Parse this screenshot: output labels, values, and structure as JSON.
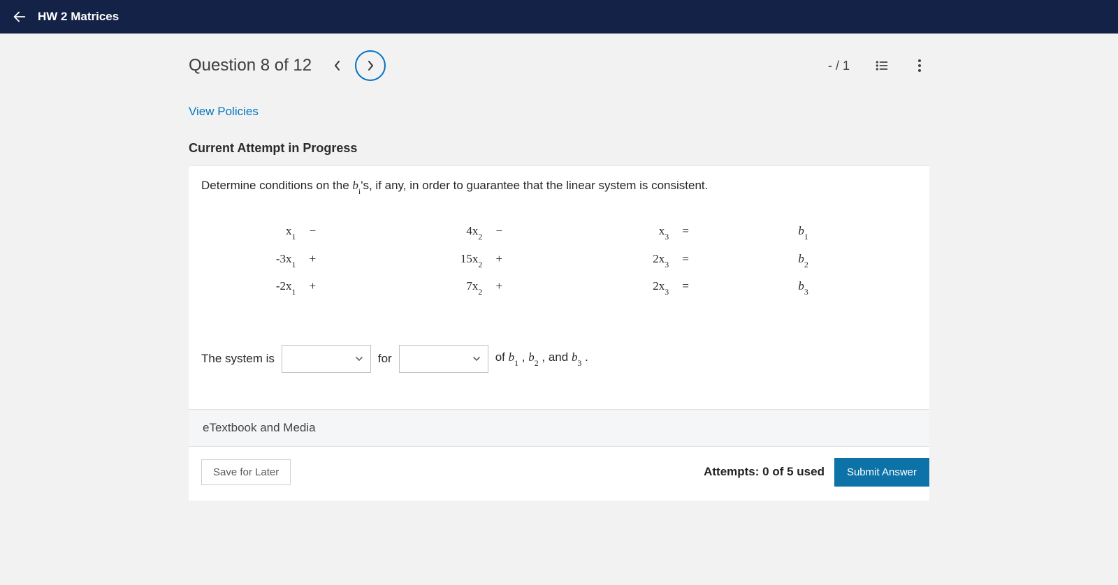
{
  "header": {
    "title": "HW 2 Matrices"
  },
  "question_nav": {
    "label": "Question 8 of 12",
    "score": "- / 1"
  },
  "links": {
    "view_policies": "View Policies"
  },
  "attempt": {
    "status_title": "Current Attempt in Progress"
  },
  "prompt": {
    "pre": "Determine conditions on the ",
    "var_html": "b_i",
    "post": "'s, if any, in order to guarantee that the linear system is consistent."
  },
  "equations": {
    "rows": [
      {
        "c1": "x",
        "s1": "1",
        "op1": "−",
        "c2": "4x",
        "s2": "2",
        "op2": "−",
        "c3": "x",
        "s3": "3",
        "eq": "=",
        "b": "b",
        "bs": "1"
      },
      {
        "c1": "-3x",
        "s1": "1",
        "op1": "+",
        "c2": "15x",
        "s2": "2",
        "op2": "+",
        "c3": "2x",
        "s3": "3",
        "eq": "=",
        "b": "b",
        "bs": "2"
      },
      {
        "c1": "-2x",
        "s1": "1",
        "op1": "+",
        "c2": "7x",
        "s2": "2",
        "op2": "+",
        "c3": "2x",
        "s3": "3",
        "eq": "=",
        "b": "b",
        "bs": "3"
      }
    ]
  },
  "answer": {
    "lead": "The system is",
    "mid": "for",
    "tail_pre": "of ",
    "tail_b1": "b",
    "tail_b1s": "1",
    "tail_sep1": " , ",
    "tail_b2": "b",
    "tail_b2s": "2",
    "tail_sep2": " , and ",
    "tail_b3": "b",
    "tail_b3s": "3",
    "tail_post": " ."
  },
  "resource": {
    "label": "eTextbook and Media"
  },
  "footer": {
    "save_label": "Save for Later",
    "attempts_label": "Attempts: 0 of 5 used",
    "submit_label": "Submit Answer"
  }
}
